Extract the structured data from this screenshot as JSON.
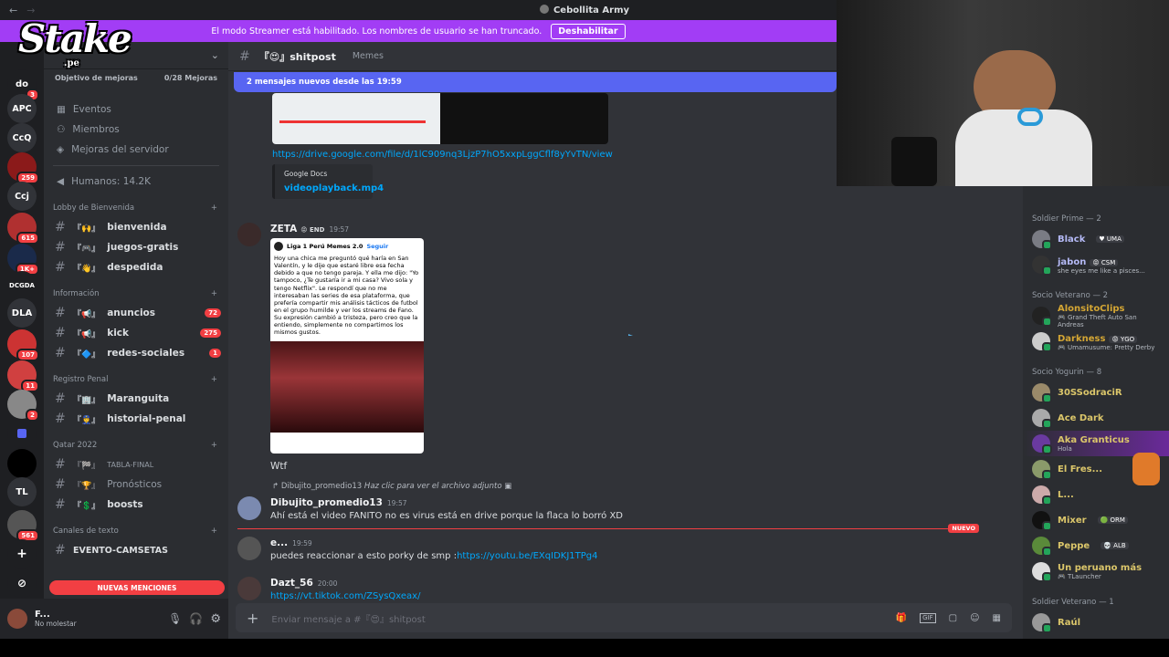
{
  "titlebar": {
    "title": "Cebollita Army"
  },
  "streamer": {
    "message": "El modo Streamer está habilitado. Los nombres de usuario se han truncado.",
    "button": "Deshabilitar"
  },
  "brand": {
    "logo": "Stake",
    "sub": ".pe"
  },
  "servers": [
    {
      "label": "do",
      "badge": "3"
    },
    {
      "label": "APC",
      "badge": ""
    },
    {
      "label": "CcQ",
      "badge": ""
    },
    {
      "label": "",
      "badge": "259"
    },
    {
      "label": "Ccj",
      "badge": ""
    },
    {
      "label": "",
      "badge": "615"
    },
    {
      "label": "",
      "badge": "1K+"
    },
    {
      "label": "DCGDA",
      "badge": ""
    },
    {
      "label": "DLA",
      "badge": ""
    },
    {
      "label": "",
      "badge": "107"
    },
    {
      "label": "",
      "badge": "11"
    },
    {
      "label": "",
      "badge": "2"
    },
    {
      "label": "",
      "badge": ""
    },
    {
      "label": "",
      "badge": ""
    },
    {
      "label": "TL",
      "badge": ""
    },
    {
      "label": "",
      "badge": "561"
    }
  ],
  "sidebar": {
    "boost_label": "Objetivo de mejoras",
    "boost_count": "0/28 Mejoras",
    "nav": [
      "Eventos",
      "Miembros",
      "Mejoras del servidor"
    ],
    "humans": "Humanos: 14.2K",
    "cat1": "Lobby de Bienvenida",
    "ch_bienvenida": "bienvenida",
    "ch_juegos": "juegos-gratis",
    "ch_despedida": "despedida",
    "cat2": "Información",
    "ch_anuncios": "anuncios",
    "cnt_anuncios": "72",
    "ch_kick": "kick",
    "cnt_kick": "275",
    "ch_redes": "redes-sociales",
    "cnt_redes": "1",
    "cat3": "Registro Penal",
    "ch_maranguita": "Maranguita",
    "ch_historial": "historial-penal",
    "cat4": "Qatar 2022",
    "ch_tabla": "TABLA-FINAL",
    "ch_pron": "Pronósticos",
    "ch_boosts": "boosts",
    "cat5": "Canales de texto",
    "ch_evento": "EVENTO-CAMSETAS",
    "mentions": "NUEVAS MENCIONES",
    "user": "F...",
    "status": "No molestar"
  },
  "channel": {
    "name": "shitpost",
    "topic": "Memes",
    "newbar": "2 mensajes nuevos desde las 19:59"
  },
  "messages": {
    "m1_link": "https://drive.google.com/file/d/1lC909nq3LjzP7hO5xxpLggCflf8yYvTN/view",
    "m1_embed_provider": "Google Docs",
    "m1_embed_title": "videoplayback.mp4",
    "m2_user": "ZETA",
    "m2_role": "END",
    "m2_time": "19:57",
    "m2_post_title": "Liga 1 Perú Memes 2.0",
    "m2_post_follow": "Seguir",
    "m2_post_text": "Hoy una chica me preguntó qué haría en San Valentín, y le dije que estaré libre esa fecha debido a que no tengo pareja. Y ella me dijo: \"Yo tampoco, ¿Te gustaría ir a mi casa? Vivo sola y tengo Netflix\". Le respondí que no me interesaban las series de esa plataforma, que prefería compartir mis análisis tácticos de futbol en el grupo humilde y ver los streams de Fano. Su expresión cambió a tristeza, pero creo que la entiendo, simplemente no compartimos los mismos gustos.",
    "m2_text": "Wtf",
    "m3_reply_user": "Dibujito_promedio13",
    "m3_reply_text": "Haz clic para ver el archivo adjunto",
    "m3_user": "Dibujito_promedio13",
    "m3_time": "19:57",
    "m3_text": "Ahí está el video FANITO no es virus  está en drive porque la flaca lo borró XD",
    "new_label": "NUEVO",
    "m4_user": "e...",
    "m4_time": "19:59",
    "m4_text": "puedes reaccionar a esto porky de smp :",
    "m4_link": "https://youtu.be/EXqIDKJ1TPg4",
    "m5_user": "Dazt_56",
    "m5_time": "20:00",
    "m5_link": "https://vt.tiktok.com/ZSysQxeax/"
  },
  "composer": {
    "placeholder": "Enviar mensaje a #『😍』shitpost"
  },
  "members": {
    "cat1": "Soldier Prime — 2",
    "m_black": "Black",
    "m_black_tag": "UMA",
    "m_jabon": "jabon",
    "m_jabon_tag": "CSM",
    "m_jabon_status": "she eyes me like a pisces...",
    "cat2": "Socio Veterano — 2",
    "m_alonsito": "AlonsitoClips",
    "m_alonsito_status": "Grand Theft Auto San Andreas",
    "m_darkness": "Darkness",
    "m_darkness_tag": "YGO",
    "m_darkness_status": "Umamusume: Pretty Derby",
    "cat3": "Socio Yogurin — 8",
    "m_30s": "30SSodraciR",
    "m_ace": "Ace Dark",
    "m_aka": "Aka Granticus",
    "m_aka_status": "Hola",
    "m_elfre": "El Fres...",
    "m_l": "L...",
    "m_mixer": "Mixer",
    "m_mixer_tag": "ORM",
    "m_peppe": "Peppe",
    "m_peppe_tag": "ALB",
    "m_peruano": "Un peruano más",
    "m_peruano_status": "TLauncher",
    "cat4": "Soldier Veterano — 1",
    "m_raul": "Raúl"
  },
  "colors": {
    "accent": "#5865f2",
    "streamer": "#a23df5",
    "danger": "#f23f43",
    "link": "#00a8fc"
  }
}
